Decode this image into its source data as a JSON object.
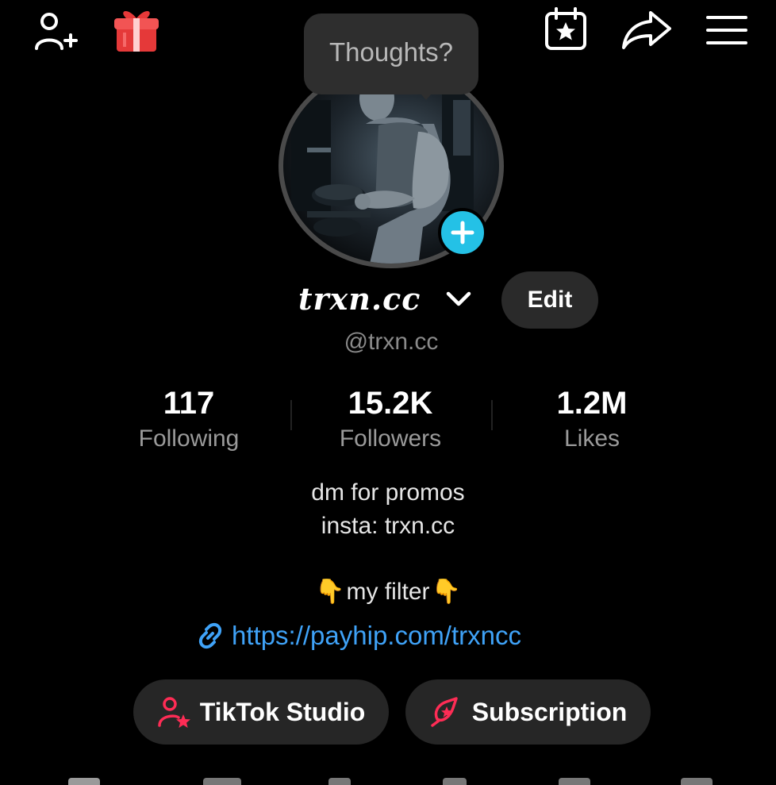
{
  "tooltip": {
    "text": "Thoughts?"
  },
  "profile": {
    "display_name": "trxn.cc",
    "handle": "@trxn.cc",
    "edit_label": "Edit"
  },
  "stats": {
    "following": {
      "value": "117",
      "label": "Following"
    },
    "followers": {
      "value": "15.2K",
      "label": "Followers"
    },
    "likes": {
      "value": "1.2M",
      "label": "Likes"
    }
  },
  "bio": {
    "line1": "dm for promos",
    "line2": "insta: trxn.cc",
    "filter_text": "my filter",
    "filter_emoji_left": "👇",
    "filter_emoji_right": "👇",
    "link": "https://payhip.com/trxncc"
  },
  "actions": {
    "studio_label": "TikTok Studio",
    "subscription_label": "Subscription"
  },
  "colors": {
    "accent_cyan": "#24c1e6",
    "link_blue": "#3fa2f7",
    "studio_red": "#fe2c55",
    "gift_red": "#e53939"
  },
  "icons": [
    "add-friend-icon",
    "gift-icon",
    "calendar-star-icon",
    "share-icon",
    "menu-icon",
    "plus-icon",
    "chevron-down-icon",
    "link-icon",
    "studio-icon",
    "subscription-icon"
  ]
}
